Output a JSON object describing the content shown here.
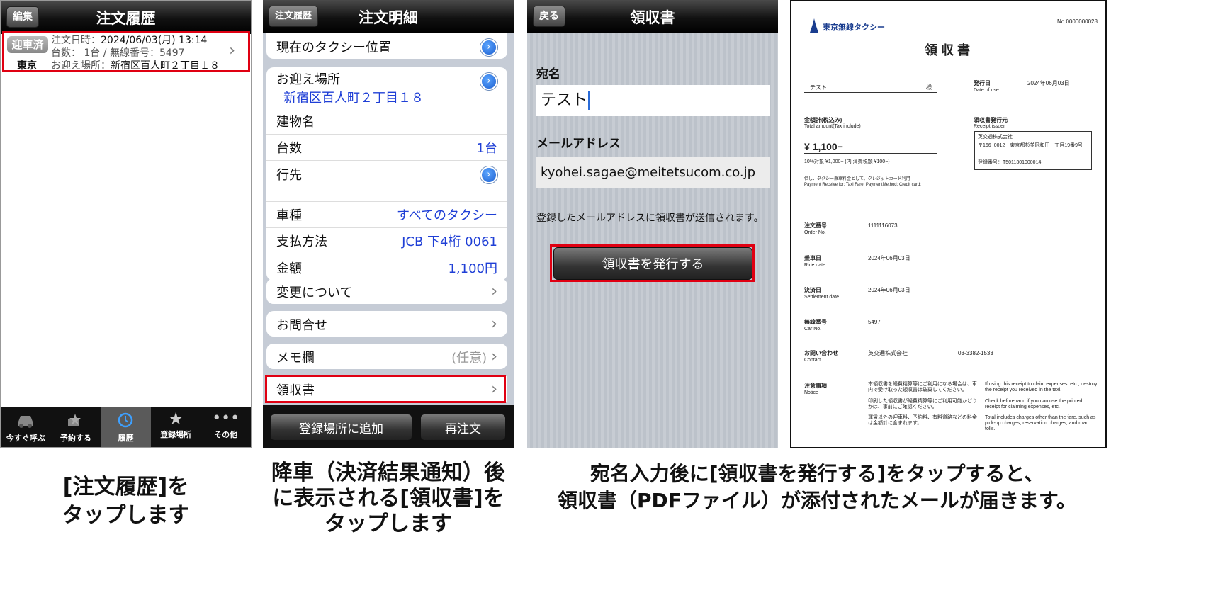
{
  "panel1": {
    "nav_edit": "編集",
    "title": "注文履歴",
    "order": {
      "status": "迎車済",
      "region": "東京",
      "datetime_label": "注文日時：",
      "datetime": "2024/06/03(月) 13:14",
      "count_line": "台数： 1台 / 無線番号：5497",
      "pickup_label": "お迎え場所：",
      "pickup": "新宿区百人町２丁目１８"
    },
    "tabs": [
      {
        "label": "今すぐ呼ぶ",
        "icon": "car-icon"
      },
      {
        "label": "予約する",
        "icon": "reserve-icon"
      },
      {
        "label": "履歴",
        "icon": "clock-icon"
      },
      {
        "label": "登録場所",
        "icon": "star-icon"
      },
      {
        "label": "その他",
        "icon": "more-icon"
      }
    ],
    "caption": [
      "[注文履歴]を",
      "タップします"
    ]
  },
  "panel2": {
    "nav_back": "注文履歴",
    "title": "注文明細",
    "taxi_position": "現在のタクシー位置",
    "pickup_label": "お迎え場所",
    "pickup_value": "新宿区百人町２丁目１８",
    "building_label": "建物名",
    "count_label": "台数",
    "count_value": "1台",
    "destination_label": "行先",
    "car_type_label": "車種",
    "car_type_value": "すべてのタクシー",
    "payment_label": "支払方法",
    "payment_value": "JCB 下4桁 0061",
    "amount_label": "金額",
    "amount_value": "1,100円",
    "change_label": "変更について",
    "contact_label": "お問合せ",
    "memo_label": "メモ欄",
    "memo_hint": "(任意)",
    "receipt_label": "領収書",
    "add_place_button": "登録場所に追加",
    "reorder_button": "再注文",
    "caption": [
      "降車（決済結果通知）後",
      "に表示される[領収書]を",
      "タップします"
    ]
  },
  "panel3": {
    "nav_back": "戻る",
    "title": "領収書",
    "name_label": "宛名",
    "name_value": "テスト",
    "email_label": "メールアドレス",
    "email_value": "kyohei.sagae@meitetsucom.co.jp",
    "notice": "登録したメールアドレスに領収書が送信されます。",
    "issue_button": "領収書を発行する"
  },
  "receipt": {
    "logo": "東京無線タクシー",
    "number": "No.0000000028",
    "title": "領 収 書",
    "addressee": "テスト",
    "honorific": "様",
    "issue_date_label": "発行日",
    "issue_date_label_en": "Date of use",
    "issue_date": "2024年06月03日",
    "total_label": "金額計(税込み)",
    "total_label_en": "Total amount(Tax include)",
    "total": "¥ 1,100−",
    "tax_note": "10%対象 ¥1,000− (内 消費税額 ¥100−)",
    "issuer_label": "領収書発行元",
    "issuer_label_en": "Receipt issuer",
    "issuer_name": "英交通株式会社",
    "issuer_address": "〒166−0012　東京都杉並区和田一丁目19番9号",
    "issuer_reg": "登録番号：T5011301000014",
    "purpose": "但し、タクシー乗車料金として。クレジットカード利用",
    "purpose_en": "Payment Receive for: Taxi Fare; PaymentMethod: Credit card;",
    "fields": [
      {
        "label": "注文番号",
        "label_en": "Order No.",
        "value": "1111116073"
      },
      {
        "label": "乗車日",
        "label_en": "Ride date",
        "value": "2024年06月03日"
      },
      {
        "label": "決済日",
        "label_en": "Settlement date",
        "value": "2024年06月03日"
      },
      {
        "label": "無線番号",
        "label_en": "Car No.",
        "value": "5497"
      }
    ],
    "contact_label": "お問い合わせ",
    "contact_label_en": "Contact",
    "contact_company": "英交通株式会社",
    "contact_phone": "03-3382-1533",
    "notes_label": "注意事項",
    "notes_label_en": "Notice",
    "notes_jp": [
      "本領収書を経費精算等にご利用になる場合は、車内で受け取った領収書は破棄してください。",
      "印刷した領収書が経費精算等にご利用可能かどうかは、事前にご確認ください。",
      "運賃以外の迎車料、予約料、有料道路などの料金は金額計に含まれます。"
    ],
    "notes_en": [
      "If using this receipt to claim expenses, etc., destroy the receipt you received in the taxi.",
      "Check beforehand if you can use the printed receipt for claiming expenses, etc.",
      "Total includes charges other than the fare, such as pick-up charges, reservation charges, and road tolls."
    ]
  },
  "caption34": [
    "宛名入力後に[領収書を発行する]をタップすると、",
    "領収書（PDFファイル）が添付されたメールが届きます。"
  ],
  "colors": {
    "highlight": "#e00012",
    "link_blue": "#1f3fd6",
    "tab_active": "#5a5a5a"
  }
}
